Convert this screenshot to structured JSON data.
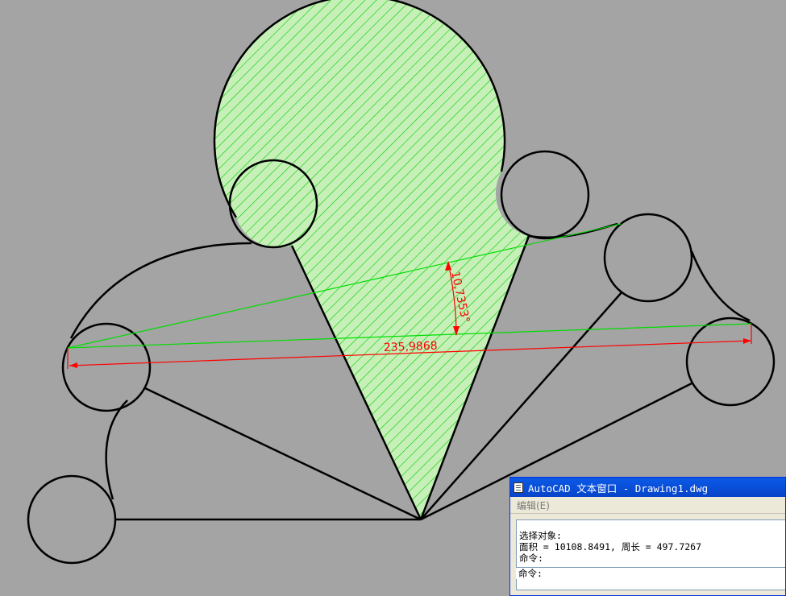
{
  "drawing": {
    "dimension_angle_label": "10,7353°",
    "dimension_length_label": "235,9868",
    "colors": {
      "background": "#a4a4a4",
      "geometry": "#000000",
      "hatch": "#00ff00",
      "dimension": "#ff0000",
      "construction": "#00ff00"
    }
  },
  "text_window": {
    "title": "AutoCAD 文本窗口 - Drawing1.dwg",
    "menu_edit": "编辑(E)",
    "lines": [
      "选择对象:",
      "面积 = 10108.8491, 周长 = 497.7267",
      "命令:"
    ],
    "prompt": "命令:"
  }
}
